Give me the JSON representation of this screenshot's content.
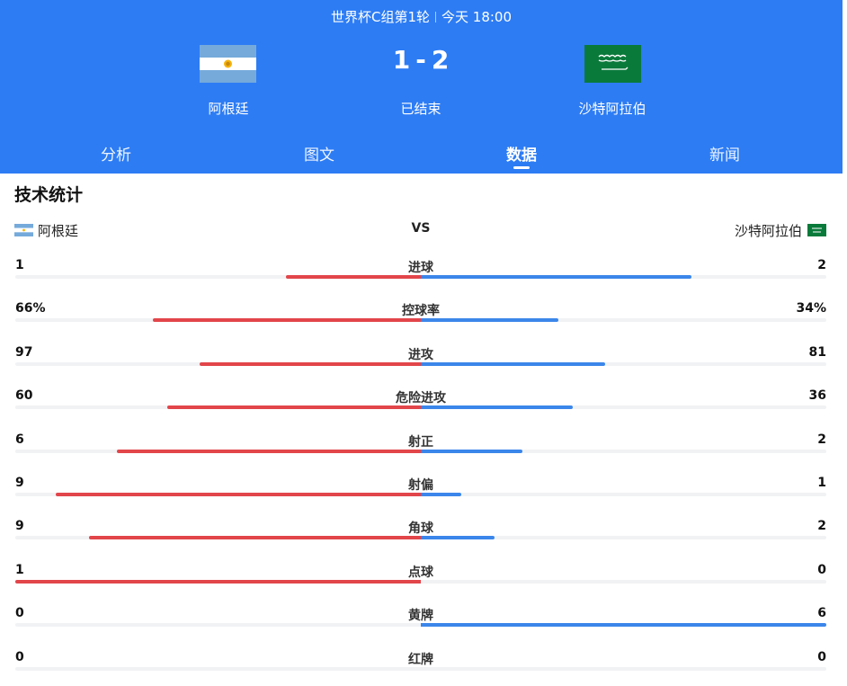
{
  "match": {
    "competition": "世界杯C组第1轮",
    "time": "今天 18:00",
    "home_team": "阿根廷",
    "away_team": "沙特阿拉伯",
    "home_score": "1",
    "away_score": "2",
    "score_separator": "-",
    "status": "已结束"
  },
  "tabs": [
    {
      "label": "分析",
      "active": false
    },
    {
      "label": "图文",
      "active": false
    },
    {
      "label": "数据",
      "active": true
    },
    {
      "label": "新闻",
      "active": false
    }
  ],
  "stats_section": {
    "title": "技术统计",
    "home_team": "阿根廷",
    "away_team": "沙特阿拉伯",
    "vs_label": "VS"
  },
  "colors": {
    "header_bg": "#2d7cf4",
    "home_bar": "#e2454a",
    "away_bar": "#3b86ea"
  },
  "icons": {
    "home_flag": "argentina-flag-icon",
    "away_flag": "saudi-arabia-flag-icon"
  },
  "stats": [
    {
      "label": "进球",
      "home": "1",
      "away": "2",
      "home_share": 0.333,
      "away_share": 0.667
    },
    {
      "label": "控球率",
      "home": "66%",
      "away": "34%",
      "home_share": 0.66,
      "away_share": 0.34
    },
    {
      "label": "进攻",
      "home": "97",
      "away": "81",
      "home_share": 0.545,
      "away_share": 0.455
    },
    {
      "label": "危险进攻",
      "home": "60",
      "away": "36",
      "home_share": 0.625,
      "away_share": 0.375
    },
    {
      "label": "射正",
      "home": "6",
      "away": "2",
      "home_share": 0.75,
      "away_share": 0.25
    },
    {
      "label": "射偏",
      "home": "9",
      "away": "1",
      "home_share": 0.9,
      "away_share": 0.1
    },
    {
      "label": "角球",
      "home": "9",
      "away": "2",
      "home_share": 0.818,
      "away_share": 0.182
    },
    {
      "label": "点球",
      "home": "1",
      "away": "0",
      "home_share": 1.0,
      "away_share": 0.0
    },
    {
      "label": "黄牌",
      "home": "0",
      "away": "6",
      "home_share": 0.0,
      "away_share": 1.0
    },
    {
      "label": "红牌",
      "home": "0",
      "away": "0",
      "home_share": 0.0,
      "away_share": 0.0
    }
  ]
}
